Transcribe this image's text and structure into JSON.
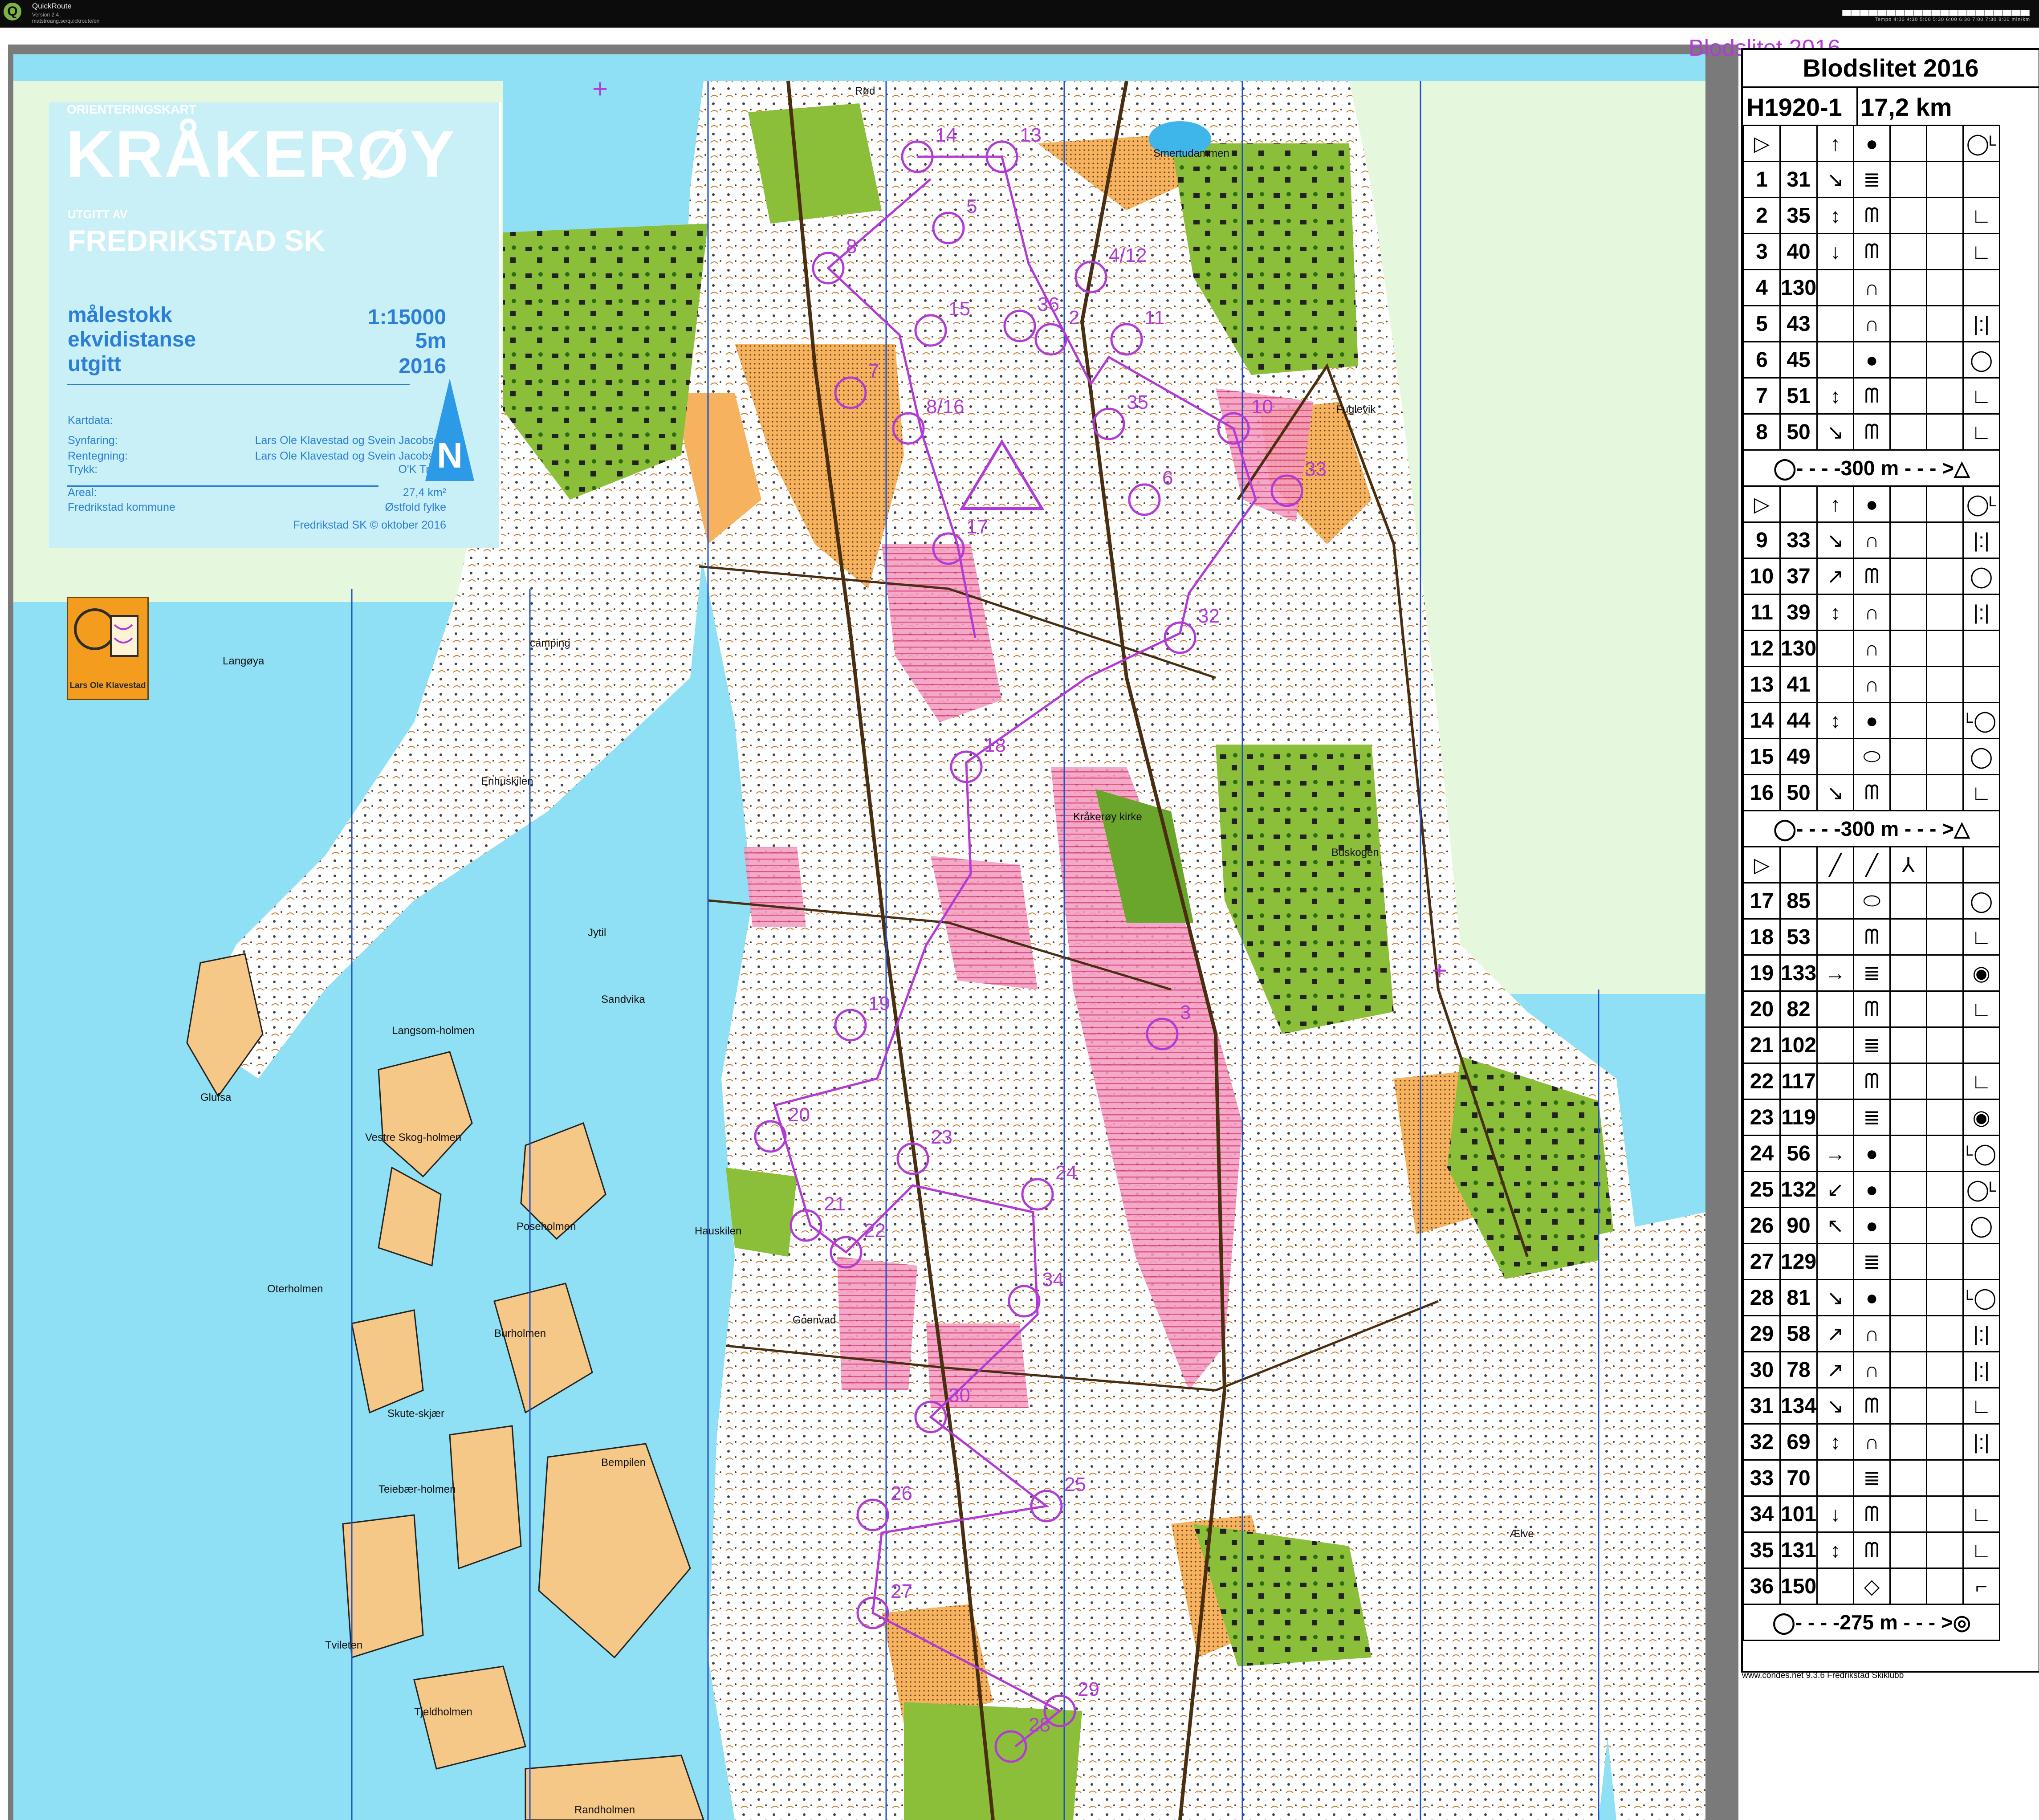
{
  "app": {
    "title": "QuickRoute",
    "version": "Version 2.4",
    "url": "matstroang.se/quickroute/en",
    "tempo_label": "Tempo 4:00 4:30 5:00 5:30 6:00 6:30 7:00 7:30 8:00 min/km"
  },
  "event_title": "Blodslitet 2016",
  "map_legend": {
    "subtitle": "ORIENTERINGSKART",
    "title": "KRÅKERØY",
    "published_by_label": "UTGITT AV",
    "club": "FREDRIKSTAD SK",
    "scale_label": "målestokk",
    "scale_value": "1:15000",
    "contour_label": "ekvidistanse",
    "contour_value": "5m",
    "year_label": "utgitt",
    "year_value": "2016",
    "data_heading": "Kartdata:",
    "survey_label": "Synfaring:",
    "survey_value": "Lars Ole Klavestad og Svein Jacobsen",
    "draw_label": "Rentegning:",
    "draw_value": "Lars Ole Klavestad og Svein Jacobsen",
    "print_label": "Trykk:",
    "print_value": "O'K Trykk",
    "area_label": "Areal:",
    "area_value": "27,4 km²",
    "owner": "Fredrikstad kommune",
    "county": "Østfold fylke",
    "copyright": "Fredrikstad SK © oktober 2016",
    "north": "N",
    "badge": "Lars Ole Klavestad"
  },
  "place_names": [
    "Rød",
    "Smertudammen",
    "Fuglevik",
    "Langøya",
    "camping",
    "Enhuskilen",
    "Kråkerøy kirke",
    "Buskogen",
    "Jytil",
    "Sandvika",
    "Langsom-holmen",
    "Glufsa",
    "Vestre Skog-holmen",
    "Poseholmen",
    "Oterholmen",
    "Burholmen",
    "Hauskilen",
    "Goenvad",
    "Skute-skjær",
    "Teiebær-holmen",
    "Bempilen",
    "Ælve",
    "Tvileten",
    "Tjeldholmen",
    "Randholmen"
  ],
  "control_labels": [
    "14",
    "13",
    "5",
    "8",
    "4/12",
    "15",
    "36",
    "2",
    "11",
    "7",
    "8/16",
    "35",
    "6",
    "33",
    "10",
    "17",
    "32",
    "18",
    "19",
    "20",
    "23",
    "24",
    "3",
    "21",
    "22",
    "34",
    "30",
    "26",
    "25",
    "27",
    "29",
    "28"
  ],
  "description_sheet": {
    "title": "Blodslitet 2016",
    "class": "H1920-1",
    "length": "17,2 km",
    "sections": [
      {
        "start_row": [
          "▷",
          "",
          "↑",
          "●",
          "",
          "",
          "◯ᴸ"
        ],
        "rows": [
          [
            "1",
            "31",
            "↘",
            "≣",
            "",
            "",
            ""
          ],
          [
            "2",
            "35",
            "↕",
            "ᗰ",
            "",
            "",
            "∟"
          ],
          [
            "3",
            "40",
            "↓",
            "ᗰ",
            "",
            "",
            "∟"
          ],
          [
            "4",
            "130",
            "",
            "∩",
            "",
            "",
            ""
          ],
          [
            "5",
            "43",
            "",
            "∩",
            "",
            "",
            "|:|"
          ],
          [
            "6",
            "45",
            "",
            "●",
            "",
            "",
            "◯"
          ],
          [
            "7",
            "51",
            "↕",
            "ᗰ",
            "",
            "",
            "∟"
          ],
          [
            "8",
            "50",
            "↘",
            "ᗰ",
            "",
            "",
            "∟"
          ]
        ],
        "leg": "◯- - - -300 m - - - >△"
      },
      {
        "start_row": [
          "▷",
          "",
          "↑",
          "●",
          "",
          "",
          "◯ᴸ"
        ],
        "rows": [
          [
            "9",
            "33",
            "↘",
            "∩",
            "",
            "",
            "|:|"
          ],
          [
            "10",
            "37",
            "↗",
            "ᗰ",
            "",
            "",
            "◯"
          ],
          [
            "11",
            "39",
            "↕",
            "∩",
            "",
            "",
            "|:|"
          ],
          [
            "12",
            "130",
            "",
            "∩",
            "",
            "",
            ""
          ],
          [
            "13",
            "41",
            "",
            "∩",
            "",
            "",
            ""
          ],
          [
            "14",
            "44",
            "↕",
            "●",
            "",
            "",
            "ᴸ◯"
          ],
          [
            "15",
            "49",
            "",
            "⬭",
            "",
            "",
            "◯"
          ],
          [
            "16",
            "50",
            "↘",
            "ᗰ",
            "",
            "",
            "∟"
          ]
        ],
        "leg": "◯- - - -300 m - - - >△"
      },
      {
        "start_row": [
          "▷",
          "",
          "╱",
          "╱",
          "⅄",
          "",
          ""
        ],
        "rows": [
          [
            "17",
            "85",
            "",
            "⬭",
            "",
            "",
            "◯"
          ],
          [
            "18",
            "53",
            "",
            "ᗰ",
            "",
            "",
            "∟"
          ],
          [
            "19",
            "133",
            "→",
            "≣",
            "",
            "",
            "◉"
          ],
          [
            "20",
            "82",
            "",
            "ᗰ",
            "",
            "",
            "∟"
          ],
          [
            "21",
            "102",
            "",
            "≣",
            "",
            "",
            ""
          ],
          [
            "22",
            "117",
            "",
            "ᗰ",
            "",
            "",
            "∟"
          ],
          [
            "23",
            "119",
            "",
            "≣",
            "",
            "",
            "◉"
          ],
          [
            "24",
            "56",
            "→",
            "●",
            "",
            "",
            "ᴸ◯"
          ],
          [
            "25",
            "132",
            "↙",
            "●",
            "",
            "",
            "◯ᴸ"
          ],
          [
            "26",
            "90",
            "↖",
            "●",
            "",
            "",
            "◯"
          ],
          [
            "27",
            "129",
            "",
            "≣",
            "",
            "",
            ""
          ],
          [
            "28",
            "81",
            "↘",
            "●",
            "",
            "",
            "ᴸ◯"
          ],
          [
            "29",
            "58",
            "↗",
            "∩",
            "",
            "",
            "|:|"
          ],
          [
            "30",
            "78",
            "↗",
            "∩",
            "",
            "",
            "|:|"
          ],
          [
            "31",
            "134",
            "↘",
            "ᗰ",
            "",
            "",
            "∟"
          ],
          [
            "32",
            "69",
            "↕",
            "∩",
            "",
            "",
            "|:|"
          ],
          [
            "33",
            "70",
            "",
            "≣",
            "",
            "",
            ""
          ],
          [
            "34",
            "101",
            "↓",
            "ᗰ",
            "",
            "",
            "∟"
          ],
          [
            "35",
            "131",
            "↕",
            "ᗰ",
            "",
            "",
            "∟"
          ],
          [
            "36",
            "150",
            "",
            "◇",
            "",
            "",
            "⌐"
          ]
        ],
        "leg": "◯- - - -275 m - - - >◎"
      }
    ],
    "footer": "www.condes.net 9.3.6 Fredrikstad Skiklubb"
  },
  "colors": {
    "water": "#8fe0f4",
    "open": "#f6b25e",
    "forest": "#ffffff",
    "green": "#6aa52c",
    "olive": "#8bbf3a",
    "course": "#b23bd6",
    "road": "#4a2e11",
    "oob": "#e7659b",
    "legend_text": "#2c7fd6"
  }
}
